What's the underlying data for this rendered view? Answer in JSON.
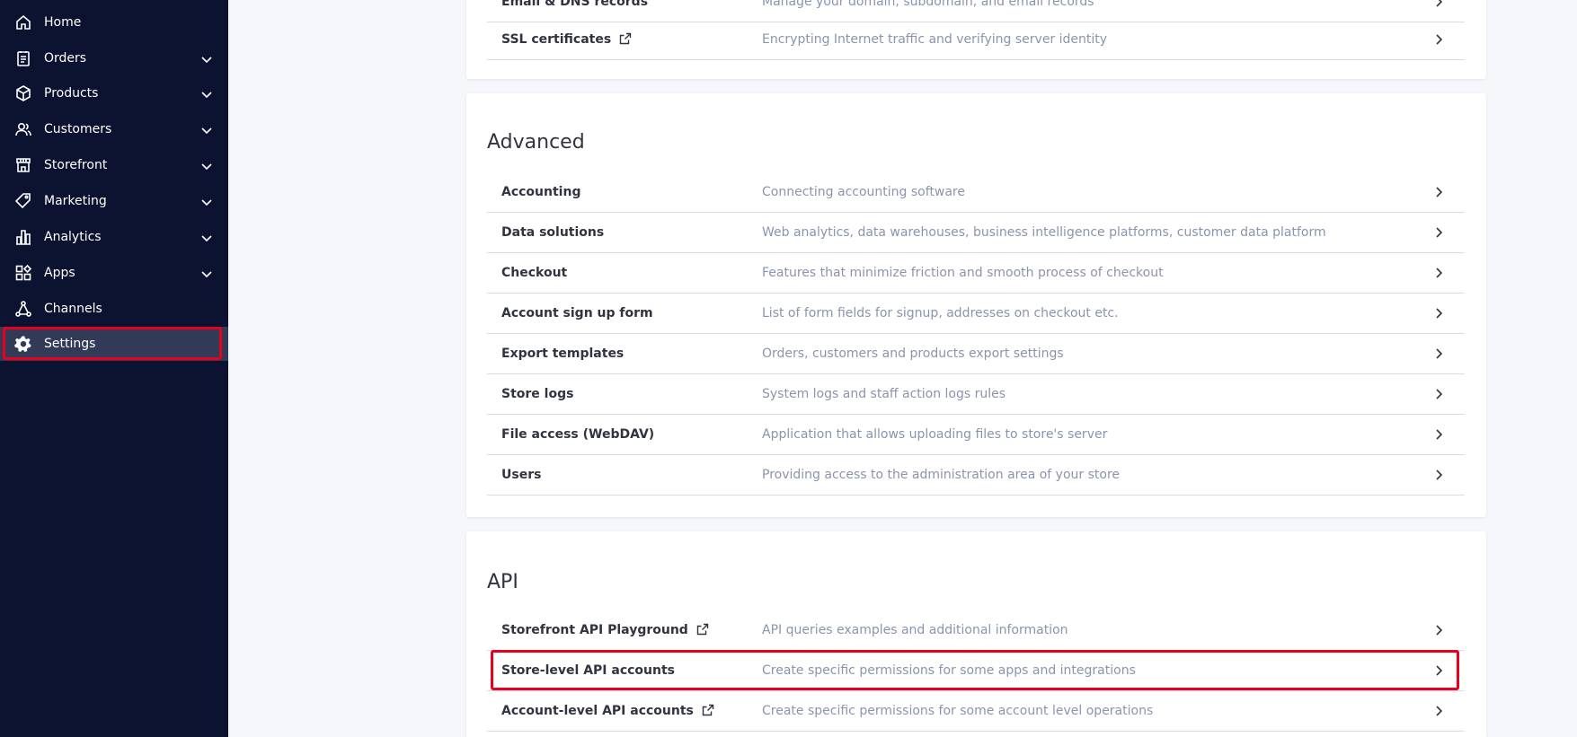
{
  "sidebar": {
    "items": [
      {
        "label": "Home",
        "icon": "home-icon",
        "has_chevron": false
      },
      {
        "label": "Orders",
        "icon": "orders-icon",
        "has_chevron": true
      },
      {
        "label": "Products",
        "icon": "products-icon",
        "has_chevron": true
      },
      {
        "label": "Customers",
        "icon": "customers-icon",
        "has_chevron": true
      },
      {
        "label": "Storefront",
        "icon": "storefront-icon",
        "has_chevron": true
      },
      {
        "label": "Marketing",
        "icon": "marketing-icon",
        "has_chevron": true
      },
      {
        "label": "Analytics",
        "icon": "analytics-icon",
        "has_chevron": true
      },
      {
        "label": "Apps",
        "icon": "apps-icon",
        "has_chevron": true
      },
      {
        "label": "Channels",
        "icon": "channels-icon",
        "has_chevron": false
      },
      {
        "label": "Settings",
        "icon": "gear-icon",
        "has_chevron": false,
        "active": true
      }
    ]
  },
  "top_section": {
    "rows": [
      {
        "title": "Email & DNS records",
        "desc": "Manage your domain, subdomain, and email records"
      },
      {
        "title": "SSL certificates",
        "desc": "Encrypting Internet traffic and verifying server identity",
        "external": true
      }
    ]
  },
  "advanced": {
    "title": "Advanced",
    "rows": [
      {
        "title": "Accounting",
        "desc": "Connecting accounting software"
      },
      {
        "title": "Data solutions",
        "desc": "Web analytics, data warehouses, business intelligence platforms, customer data platform"
      },
      {
        "title": "Checkout",
        "desc": "Features that minimize friction and smooth process of checkout"
      },
      {
        "title": "Account sign up form",
        "desc": "List of form fields for signup, addresses on checkout etc."
      },
      {
        "title": "Export templates",
        "desc": "Orders, customers and products export settings"
      },
      {
        "title": "Store logs",
        "desc": "System logs and staff action logs rules"
      },
      {
        "title": "File access (WebDAV)",
        "desc": "Application that allows uploading files to store's server"
      },
      {
        "title": "Users",
        "desc": "Providing access to the administration area of your store"
      }
    ]
  },
  "api": {
    "title": "API",
    "rows": [
      {
        "title": "Storefront API Playground",
        "desc": "API queries examples and additional information",
        "external": true
      },
      {
        "title": "Store-level API accounts",
        "desc": "Create specific permissions for some apps and integrations"
      },
      {
        "title": "Account-level API accounts",
        "desc": "Create specific permissions for some account level operations",
        "external": true
      }
    ]
  },
  "colors": {
    "sidebar_bg": "#0c1330",
    "active_bg": "#313b58",
    "highlight": "#e8001c",
    "desc_text": "#8c93ad"
  }
}
